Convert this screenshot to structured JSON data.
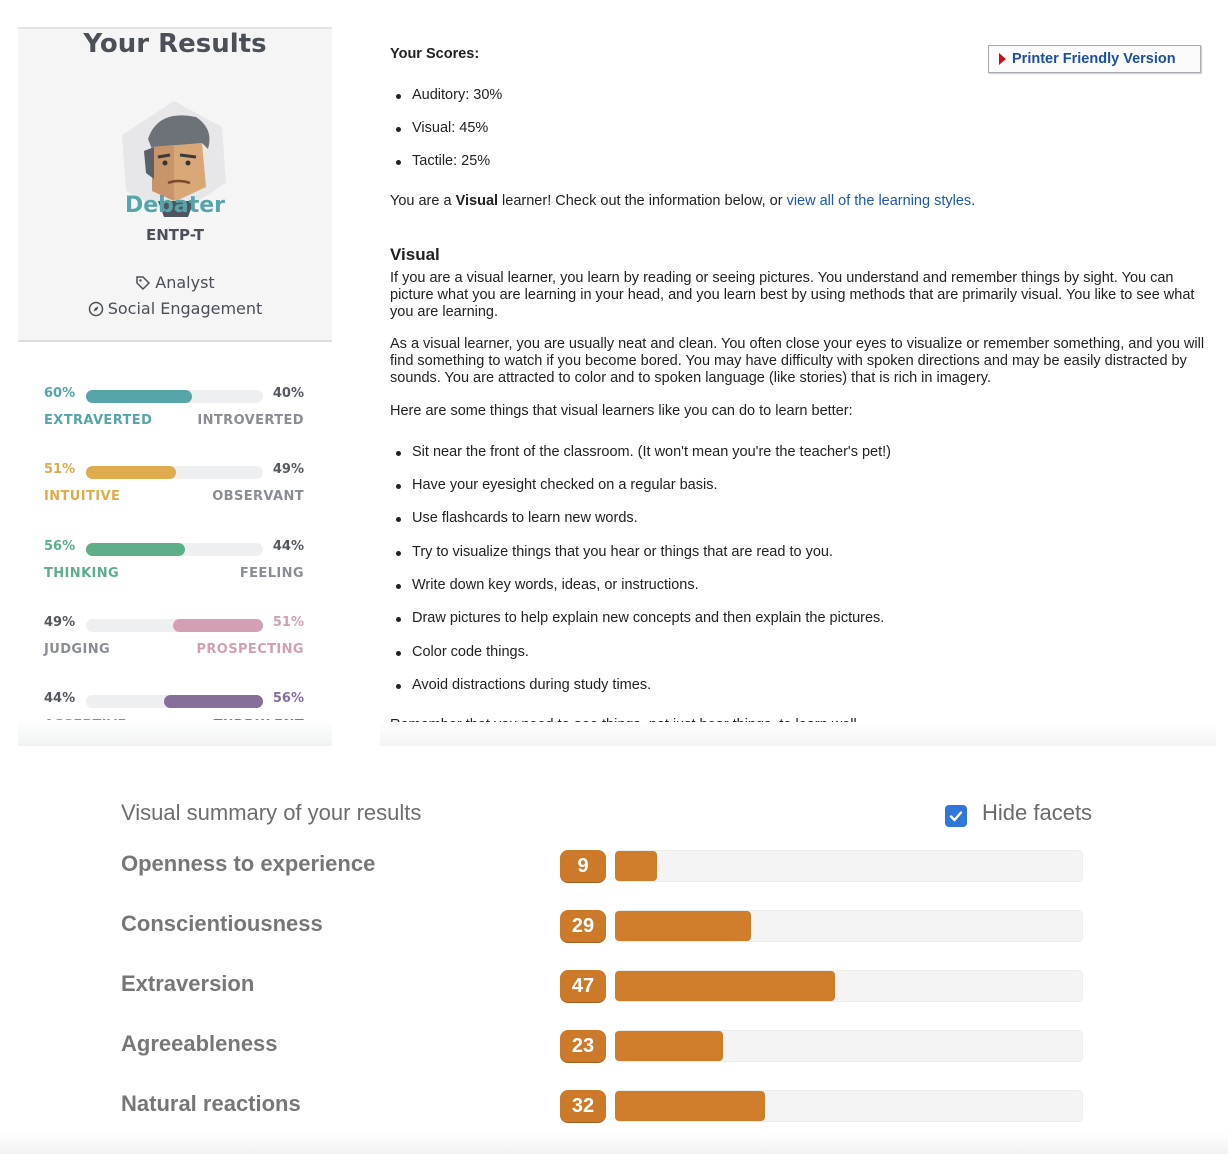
{
  "personality": {
    "title": "Your Results",
    "type_name": "Debater",
    "type_code": "ENTP-T",
    "role": "Analyst",
    "strategy": "Social Engagement",
    "colors": {
      "teal": "#56a5a9",
      "yellow": "#e0ab4d",
      "green": "#5fae8a",
      "pink": "#d29fb5",
      "purple": "#876f9a"
    },
    "traits": [
      {
        "left_pct": "60%",
        "right_pct": "40%",
        "left_label": "EXTRAVERTED",
        "right_label": "INTROVERTED",
        "value": 0.6,
        "dominant": "left",
        "color": "#56a5a9"
      },
      {
        "left_pct": "51%",
        "right_pct": "49%",
        "left_label": "INTUITIVE",
        "right_label": "OBSERVANT",
        "value": 0.51,
        "dominant": "left",
        "color": "#e0ab4d"
      },
      {
        "left_pct": "56%",
        "right_pct": "44%",
        "left_label": "THINKING",
        "right_label": "FEELING",
        "value": 0.56,
        "dominant": "left",
        "color": "#5fae8a"
      },
      {
        "left_pct": "49%",
        "right_pct": "51%",
        "left_label": "JUDGING",
        "right_label": "PROSPECTING",
        "value": 0.51,
        "dominant": "right",
        "color": "#d29fb5"
      },
      {
        "left_pct": "44%",
        "right_pct": "56%",
        "left_label": "ASSERTIVE",
        "right_label": "TURBULENT",
        "value": 0.56,
        "dominant": "right",
        "color": "#876f9a"
      }
    ]
  },
  "learning": {
    "scores_heading": "Your Scores:",
    "printer_button": "Printer Friendly Version",
    "scores": [
      "Auditory: 30%",
      "Visual: 45%",
      "Tactile: 25%"
    ],
    "result_prefix": "You are a ",
    "result_type": "Visual",
    "result_middle": " learner! Check out the information below, or ",
    "result_link": "view all of the learning styles",
    "result_end": ".",
    "section_heading": "Visual",
    "para1": "If you are a visual learner, you learn by reading or seeing pictures. You understand and remember things by sight. You can picture what you are learning in your head, and you learn best by using methods that are primarily visual. You like to see what you are learning.",
    "para2": "As a visual learner, you are usually neat and clean. You often close your eyes to visualize or remember something, and you will find something to watch if you become bored. You may have difficulty with spoken directions and may be easily distracted by sounds. You are attracted to color and to spoken language (like stories) that is rich in imagery.",
    "tips_intro": "Here are some things that visual learners like you can do to learn better:",
    "tips": [
      "Sit near the front of the classroom. (It won't mean you're the teacher's pet!)",
      "Have your eyesight checked on a regular basis.",
      "Use flashcards to learn new words.",
      "Try to visualize things that you hear or things that are read to you.",
      "Write down key words, ideas, or instructions.",
      "Draw pictures to help explain new concepts and then explain the pictures.",
      "Color code things.",
      "Avoid distractions during study times."
    ],
    "closing_prefix": "Remember that you need to ",
    "closing_bold": "see",
    "closing_suffix": " things, not just hear things, to learn well."
  },
  "summary": {
    "title": "Visual summary of your results",
    "hide_facets_label": "Hide facets",
    "hide_facets_checked": true,
    "accent": "#d07d2b",
    "factors": [
      {
        "label": "Openness to experience",
        "score": "9",
        "value": 9
      },
      {
        "label": "Conscientiousness",
        "score": "29",
        "value": 29
      },
      {
        "label": "Extraversion",
        "score": "47",
        "value": 47
      },
      {
        "label": "Agreeableness",
        "score": "23",
        "value": 23
      },
      {
        "label": "Natural reactions",
        "score": "32",
        "value": 32
      }
    ]
  }
}
